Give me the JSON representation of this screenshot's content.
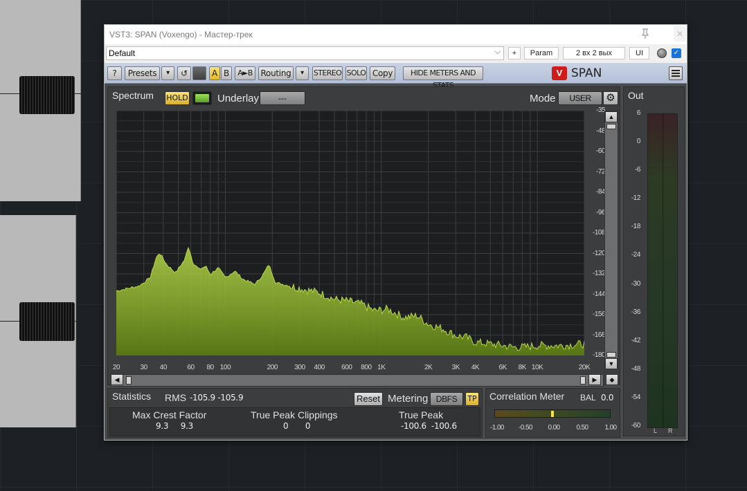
{
  "window": {
    "title": "VST3: SPAN (Voxengo) - Мастер-трек",
    "close_label": "✕"
  },
  "hostbar": {
    "preset": "Default",
    "plus": "+",
    "param": "Param",
    "io": "2 вх 2 вых",
    "ui": "UI",
    "check": "✓"
  },
  "toolbar": {
    "help": "?",
    "presets": "Presets",
    "dropdown": "▾",
    "undo": "↺",
    "a": "A",
    "b": "B",
    "ab": "A►B",
    "routing": "Routing",
    "stereo": "STEREO",
    "solo": "SOLO",
    "copy": "Copy",
    "hide_meters": "HIDE METERS AND STATS",
    "logo": "V",
    "brand": "SPAN"
  },
  "spectrum": {
    "tab_label": "Spectrum",
    "hold": "HOLD",
    "underlay_label": "Underlay",
    "underlay_value": "---",
    "mode_label": "Mode",
    "mode_value": "USER",
    "gear": "⚙",
    "y_ticks": [
      "-35",
      "-48",
      "-60",
      "-72",
      "-84",
      "-96",
      "-108",
      "-120",
      "-132",
      "-144",
      "-156",
      "-168",
      "-180"
    ],
    "x_ticks": [
      "20",
      "30",
      "40",
      "60",
      "80",
      "100",
      "200",
      "300",
      "400",
      "600",
      "800",
      "1K",
      "2K",
      "3K",
      "4K",
      "6K",
      "8K",
      "10K",
      "20K"
    ]
  },
  "scroll": {
    "up": "▲",
    "down": "▼",
    "left": "◀",
    "right": "▶",
    "diamond": "◆"
  },
  "out": {
    "label": "Out",
    "ticks": [
      "6",
      "0",
      "-6",
      "-12",
      "-18",
      "-24",
      "-30",
      "-36",
      "-42",
      "-48",
      "-54",
      "-60"
    ],
    "left_ch": "L",
    "right_ch": "R"
  },
  "statistics": {
    "label": "Statistics",
    "rms_label": "RMS",
    "rms_value": "-105.9  -105.9",
    "reset": "Reset",
    "metering_label": "Metering",
    "metering_value": "DBFS",
    "tp": "TP",
    "max_crest_label": "Max Crest Factor",
    "max_crest_values": "9.3     9.3",
    "tp_clip_label": "True Peak Clippings",
    "tp_clip_values": "0       0",
    "true_peak_label": "True Peak",
    "true_peak_values": "-100.6  -100.6"
  },
  "correlation": {
    "label": "Correlation Meter",
    "bal_label": "BAL",
    "bal_value": "0.0",
    "ticks": [
      "-1.00",
      "-0.50",
      "0.00",
      "0.50",
      "1.00"
    ],
    "value": 0.0
  },
  "colors": {
    "spectrum_fill": "#5a7a14",
    "spectrum_stroke": "#b6d84a",
    "toolbar_bg": "#bcc6da",
    "accent_yellow": "#f2cf4a"
  }
}
